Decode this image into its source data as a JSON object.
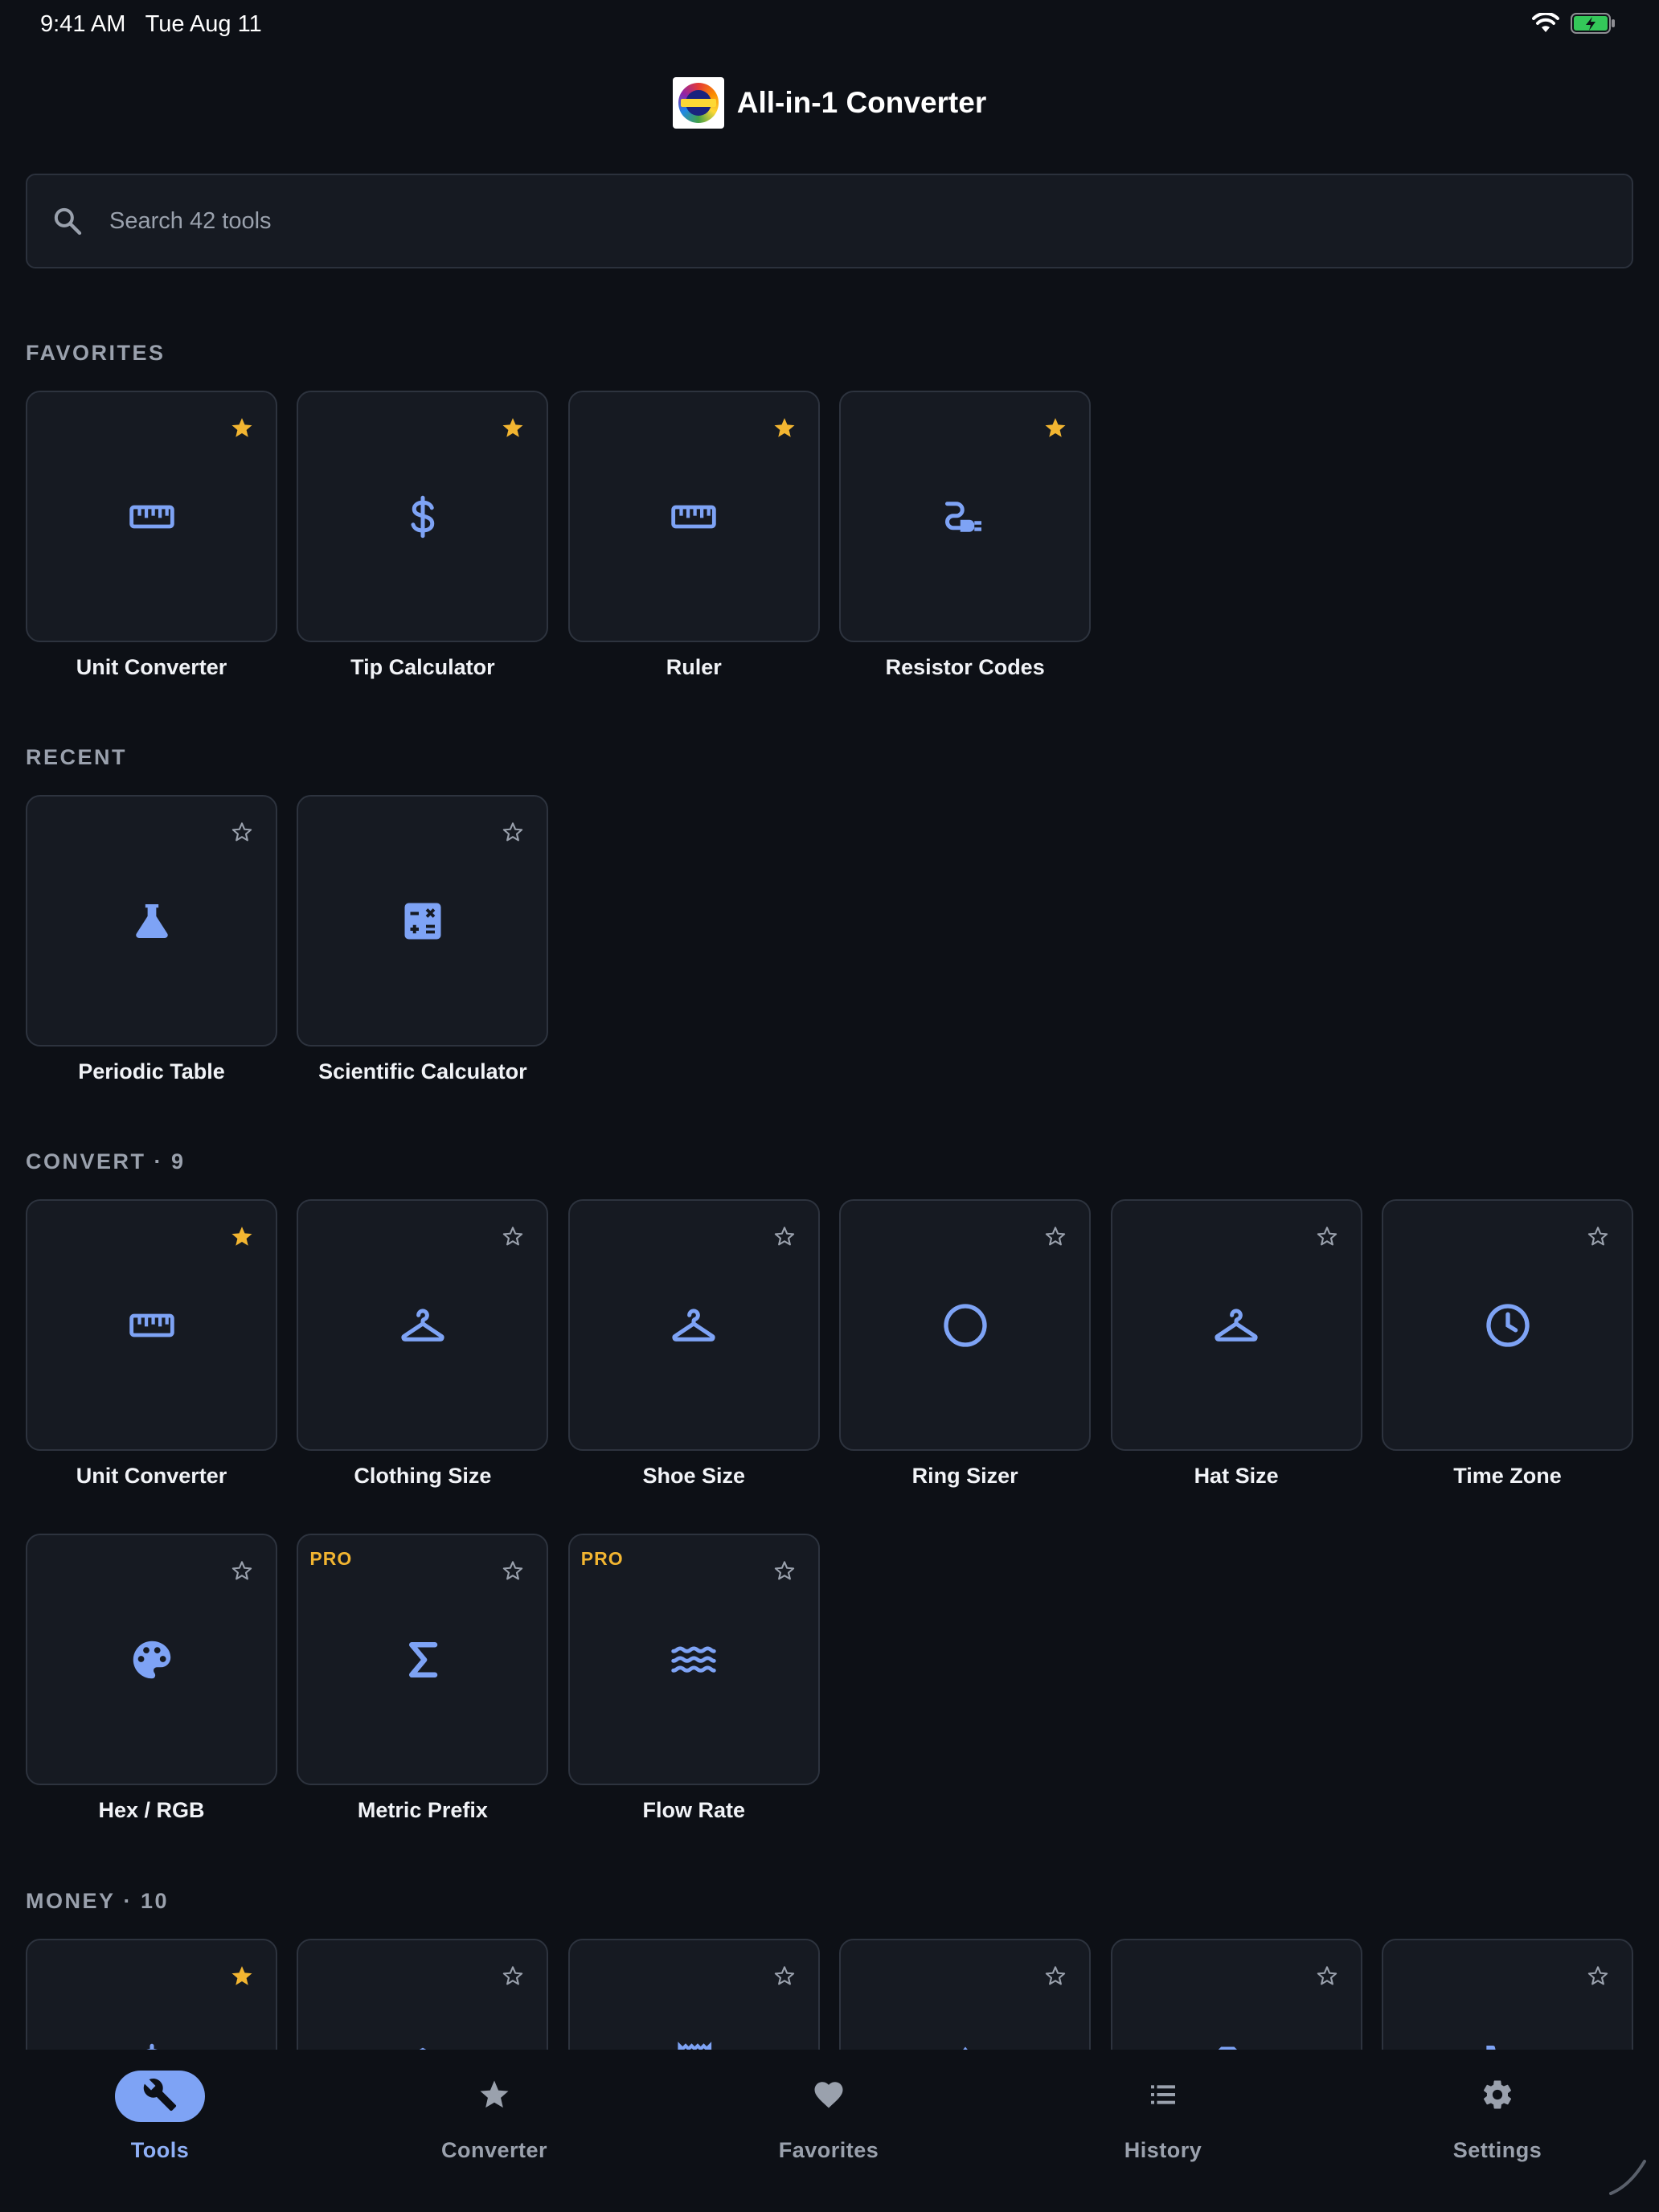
{
  "status_bar": {
    "time": "9:41 AM",
    "date": "Tue Aug 11",
    "battery_color": "#34c759"
  },
  "header": {
    "title": "All-in-1 Converter"
  },
  "search": {
    "placeholder": "Search 42 tools",
    "value": ""
  },
  "colors": {
    "accent": "#7ea3f5",
    "star_filled": "#f2b531",
    "pro_badge": "#f2b531",
    "tile_bg": "#161a22",
    "page_bg": "#0d1016"
  },
  "sections": {
    "favorites": {
      "title": "FAVORITES",
      "tiles": [
        {
          "label": "Unit Converter",
          "icon": "ruler-icon",
          "favorite": true
        },
        {
          "label": "Tip Calculator",
          "icon": "dollar-icon",
          "favorite": true
        },
        {
          "label": "Ruler",
          "icon": "ruler-icon",
          "favorite": true
        },
        {
          "label": "Resistor Codes",
          "icon": "power-plug-icon",
          "favorite": true
        }
      ]
    },
    "recent": {
      "title": "RECENT",
      "tiles": [
        {
          "label": "Periodic Table",
          "icon": "flask-icon",
          "favorite": false
        },
        {
          "label": "Scientific Calculator",
          "icon": "calculator-icon",
          "favorite": false
        }
      ]
    },
    "convert": {
      "title": "CONVERT",
      "separator": "·",
      "count": "9",
      "tiles": [
        {
          "label": "Unit Converter",
          "icon": "ruler-icon",
          "favorite": true
        },
        {
          "label": "Clothing Size",
          "icon": "hanger-icon",
          "favorite": false
        },
        {
          "label": "Shoe Size",
          "icon": "hanger-icon",
          "favorite": false
        },
        {
          "label": "Ring Sizer",
          "icon": "circle-icon",
          "favorite": false
        },
        {
          "label": "Hat Size",
          "icon": "hanger-icon",
          "favorite": false
        },
        {
          "label": "Time Zone",
          "icon": "clock-icon",
          "favorite": false
        },
        {
          "label": "Hex / RGB",
          "icon": "palette-icon",
          "favorite": false
        },
        {
          "label": "Metric Prefix",
          "icon": "sigma-icon",
          "favorite": false,
          "badge": "PRO"
        },
        {
          "label": "Flow Rate",
          "icon": "waves-icon",
          "favorite": false,
          "badge": "PRO"
        }
      ]
    },
    "money": {
      "title": "MONEY",
      "separator": "·",
      "count": "10",
      "tiles": [
        {
          "icon": "dollar-icon",
          "favorite": true
        },
        {
          "icon": "bank-icon",
          "favorite": false
        },
        {
          "icon": "receipt-icon",
          "favorite": false
        },
        {
          "icon": "trend-icon",
          "favorite": false
        },
        {
          "icon": "tag-icon",
          "favorite": false
        },
        {
          "icon": "cart-icon",
          "favorite": false
        }
      ]
    }
  },
  "bottom_nav": {
    "items": [
      {
        "label": "Tools",
        "icon": "wrench-icon",
        "active": true
      },
      {
        "label": "Converter",
        "icon": "star-icon",
        "active": false
      },
      {
        "label": "Favorites",
        "icon": "heart-icon",
        "active": false
      },
      {
        "label": "History",
        "icon": "list-icon",
        "active": false
      },
      {
        "label": "Settings",
        "icon": "gear-icon",
        "active": false
      }
    ]
  }
}
